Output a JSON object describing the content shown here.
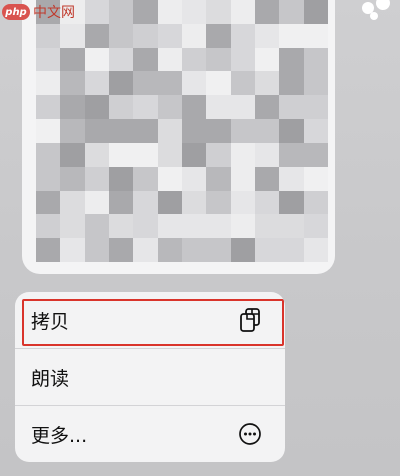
{
  "watermark": {
    "logo": "php",
    "text": "中文网"
  },
  "menu": {
    "items": [
      {
        "label": "拷贝",
        "icon": "copy-icon"
      },
      {
        "label": "朗读",
        "icon": ""
      },
      {
        "label": "更多...",
        "icon": "ellipsis-circle-icon"
      }
    ]
  },
  "colors": {
    "highlight": "#d9342b",
    "menu_bg": "#f3f3f4",
    "backdrop": "#c9c9cb"
  }
}
